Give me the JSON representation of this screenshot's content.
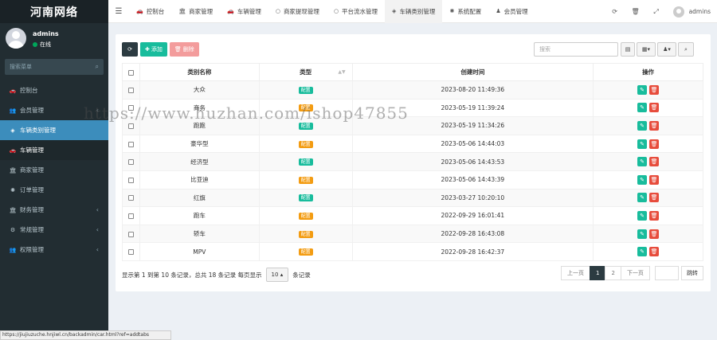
{
  "sidebar": {
    "logo": "河南网络",
    "user_name": "admins",
    "user_status": "在线",
    "search_placeholder": "搜索菜单",
    "items": [
      {
        "label": "控制台",
        "icon": "car-icon",
        "glyph": "🚗"
      },
      {
        "label": "会员管理",
        "icon": "users-icon",
        "glyph": "👥",
        "chevron": true
      },
      {
        "label": "车辆类别管理",
        "icon": "cube-icon",
        "glyph": "◈",
        "active": true
      },
      {
        "label": "车辆管理",
        "icon": "car-icon",
        "glyph": "🚗",
        "sub": true
      },
      {
        "label": "商家管理",
        "icon": "bank-icon",
        "glyph": "🏛"
      },
      {
        "label": "订单管理",
        "icon": "gear-icon",
        "glyph": "✺"
      },
      {
        "label": "财务管理",
        "icon": "bank-icon",
        "glyph": "🏛",
        "chevron": true
      },
      {
        "label": "常规管理",
        "icon": "cogs-icon",
        "glyph": "⚙",
        "chevron": true
      },
      {
        "label": "权限管理",
        "icon": "users-icon",
        "glyph": "👥",
        "chevron": true
      }
    ]
  },
  "status_bar_url": "https://jiujiuzuche.hnjiwl.cn/backadmin/car.html?ref=addtabs",
  "topbar": {
    "tabs": [
      {
        "label": "控制台",
        "icon": "car-icon",
        "glyph": "🚗"
      },
      {
        "label": "商家管理",
        "icon": "bank-icon",
        "glyph": "🏛"
      },
      {
        "label": "车辆管理",
        "icon": "car-icon",
        "glyph": "🚗"
      },
      {
        "label": "商家提现管理",
        "icon": "circle-icon",
        "glyph": "○"
      },
      {
        "label": "平台流水管理",
        "icon": "circle-icon",
        "glyph": "○"
      },
      {
        "label": "车辆类别管理",
        "icon": "cube-icon",
        "glyph": "◈",
        "active": true
      },
      {
        "label": "系统配置",
        "icon": "gear-icon",
        "glyph": "✺"
      },
      {
        "label": "会员管理",
        "icon": "user-icon",
        "glyph": "♟"
      }
    ],
    "user": "admins"
  },
  "toolbar": {
    "add_label": "添加",
    "delete_label": "删除",
    "search_placeholder": "搜索"
  },
  "table": {
    "headers": [
      "类别名称",
      "类型",
      "创建时间",
      "操作"
    ],
    "type_label": "配置",
    "rows": [
      {
        "name": "大众",
        "type_color": "#18bc9c",
        "time": "2023-08-20 11:49:36"
      },
      {
        "name": "商务",
        "type_color": "#f39c12",
        "time": "2023-05-19 11:39:24"
      },
      {
        "name": "跑跑",
        "type_color": "#18bc9c",
        "time": "2023-05-19 11:34:26"
      },
      {
        "name": "豪华型",
        "type_color": "#f39c12",
        "time": "2023-05-06 14:44:03"
      },
      {
        "name": "经济型",
        "type_color": "#18bc9c",
        "time": "2023-05-06 14:43:53"
      },
      {
        "name": "比亚迪",
        "type_color": "#f39c12",
        "time": "2023-05-06 14:43:39"
      },
      {
        "name": "红旗",
        "type_color": "#18bc9c",
        "time": "2023-03-27 10:20:10"
      },
      {
        "name": "跑车",
        "type_color": "#f39c12",
        "time": "2022-09-29 16:01:41"
      },
      {
        "name": "轿车",
        "type_color": "#f39c12",
        "time": "2022-09-28 16:43:08"
      },
      {
        "name": "MPV",
        "type_color": "#f39c12",
        "time": "2022-09-28 16:42:37"
      }
    ]
  },
  "footer": {
    "info": "显示第 1 到第 10 条记录，总共 18 条记录 每页显示",
    "page_size": "10",
    "suffix": "条记录"
  },
  "pager": {
    "prev": "上一页",
    "pages": [
      "1",
      "2"
    ],
    "current": "1",
    "next": "下一页",
    "go": "跳转"
  },
  "watermark": "https://www.huzhan.com/ishop47855"
}
